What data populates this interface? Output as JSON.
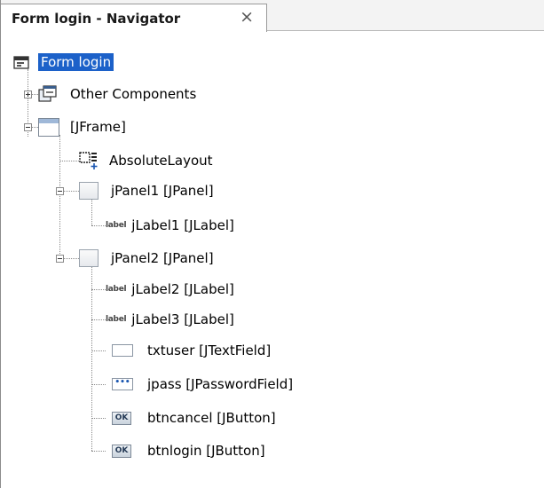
{
  "tab": {
    "title": "Form login - Navigator",
    "close_glyph": "×"
  },
  "tree": {
    "root": "Form login",
    "other_components": "Other Components",
    "jframe": "[JFrame]",
    "absolute_layout": "AbsoluteLayout",
    "jpanel1": "jPanel1 [JPanel]",
    "jlabel1": "jLabel1 [JLabel]",
    "jpanel2": "jPanel2 [JPanel]",
    "jlabel2": "jLabel2 [JLabel]",
    "jlabel3": "jLabel3 [JLabel]",
    "txtuser": "txtuser [JTextField]",
    "jpass": "jpass [JPasswordField]",
    "btncancel": "btncancel [JButton]",
    "btnlogin": "btnlogin [JButton]"
  },
  "icons": {
    "label_glyph": "label",
    "button_glyph": "OK",
    "password_glyph": "•••"
  },
  "colors": {
    "selection": "#1c61c9"
  }
}
